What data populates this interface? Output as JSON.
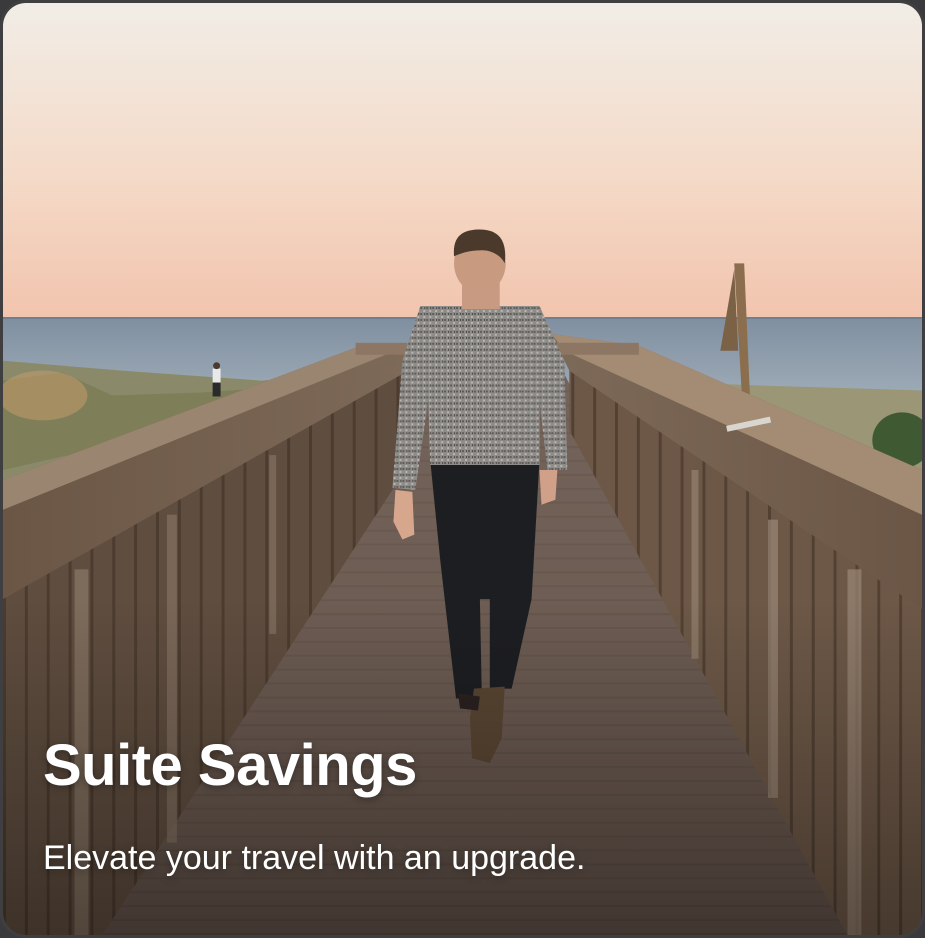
{
  "card": {
    "title": "Suite Savings",
    "subtitle": "Elevate your travel with an upgrade.",
    "image": {
      "subject": "person walking on boardwalk toward ocean at sunset"
    }
  },
  "colors": {
    "sky_top": "#f1ece4",
    "sky_horizon": "#f3c8b2",
    "ocean": "#8d9cab",
    "deck": "#6f5f55",
    "railing": "#8a7460",
    "text": "#ffffff"
  }
}
